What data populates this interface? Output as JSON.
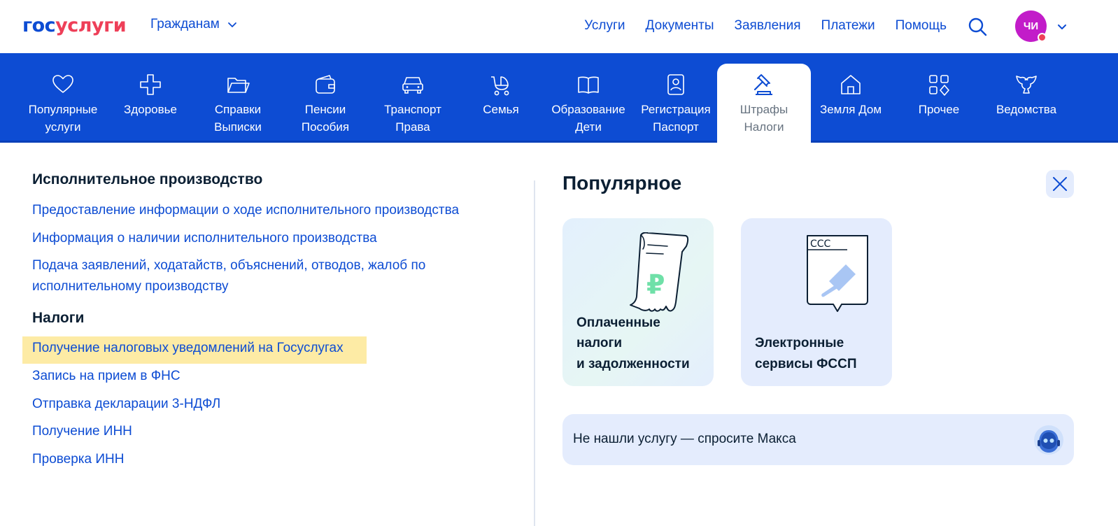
{
  "header": {
    "logo_a": "гос",
    "logo_b": "услуги",
    "audience": "Гражданам",
    "nav": [
      "Услуги",
      "Документы",
      "Заявления",
      "Платежи",
      "Помощь"
    ],
    "avatar_initials": "ЧИ"
  },
  "categories": [
    {
      "label": "Популярные\nуслуги",
      "icon": "heart-icon"
    },
    {
      "label": "Здоровье",
      "icon": "medical-cross-icon"
    },
    {
      "label": "Справки\nВыписки",
      "icon": "folder-icon"
    },
    {
      "label": "Пенсии\nПособия",
      "icon": "wallet-icon"
    },
    {
      "label": "Транспорт\nПрава",
      "icon": "car-icon"
    },
    {
      "label": "Семья",
      "icon": "stroller-icon"
    },
    {
      "label": "Образование\nДети",
      "icon": "book-icon"
    },
    {
      "label": "Регистрация\nПаспорт",
      "icon": "passport-icon"
    },
    {
      "label": "Штрафы\nНалоги",
      "icon": "gavel-icon",
      "active": true
    },
    {
      "label": "Земля Дом",
      "icon": "house-icon"
    },
    {
      "label": "Прочее",
      "icon": "grid-icon"
    },
    {
      "label": "Ведомства",
      "icon": "eagle-icon"
    }
  ],
  "left": {
    "section1_title": "Исполнительное производство",
    "section1_links": [
      "Предоставление информации о ходе исполнительного производства",
      "Информация о наличии исполнительного производства",
      "Подача заявлений, ходатайств, объяснений, отводов, жалоб по исполнительному производству"
    ],
    "section2_title": "Налоги",
    "section2_links": [
      "Получение налоговых уведомлений на Госуслугах",
      "Запись на прием в ФНС",
      "Отправка декларации 3-НДФЛ",
      "Получение ИНН",
      "Проверка ИНН"
    ]
  },
  "right": {
    "title": "Популярное",
    "cards": [
      {
        "title": "Оплаченные\nналоги\nи задолженности"
      },
      {
        "title": "Электронные\nсервисы ФССП"
      }
    ],
    "ask_text": "Не нашли услугу — спросите Макса"
  },
  "colors": {
    "brand_blue": "#0d4cd3",
    "brand_red": "#ee3f58",
    "highlight": "#fdeba5",
    "avatar": "#c21cc9"
  }
}
